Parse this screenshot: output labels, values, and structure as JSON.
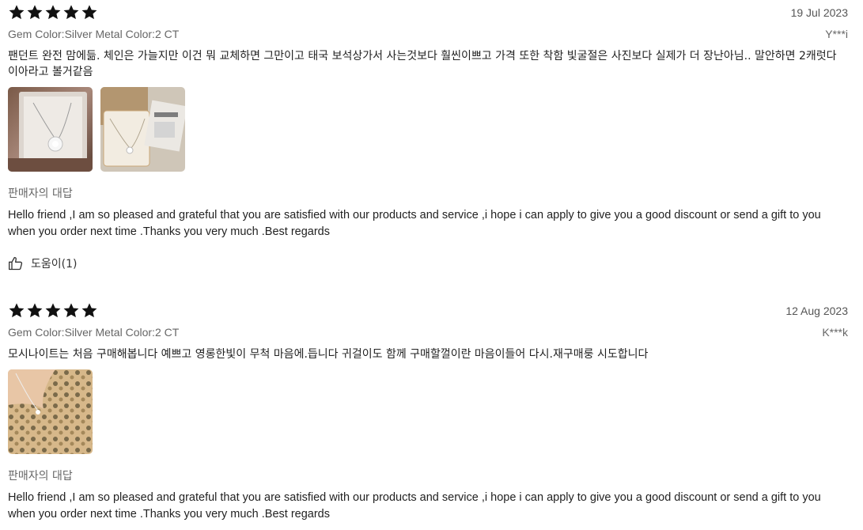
{
  "reviews": [
    {
      "rating": 5,
      "date": "19 Jul 2023",
      "attributes": "Gem Color:Silver Metal Color:2 CT",
      "user": "Y***i",
      "text": "팬던트 완전 맘에듦. 체인은 가늘지만 이건 뭐 교체하면 그만이고 태국 보석상가서 사는것보다 훨씬이쁘고 가격 또한 착함 빛굴절은 사진보다 실제가 더 장난아님.. 말안하면 2캐럿다이아라고 볼거같음",
      "photos": [
        "necklace-photo",
        "jewelry-box-photo"
      ],
      "seller_reply_title": "판매자의 대답",
      "seller_reply": "Hello friend ,I am so pleased and grateful that you are satisfied with our products and service ,i hope i can apply to give you a good discount or send a gift to you when you order next time .Thanks you very much .Best regards",
      "helpful_label": "도움이(1)"
    },
    {
      "rating": 5,
      "date": "12 Aug 2023",
      "attributes": "Gem Color:Silver Metal Color:2 CT",
      "user": "K***k",
      "text": "모시나이트는 처음 구매해봅니다 예쁘고 영롱한빛이 무척 마음에.듭니다 귀걸이도 함께 구매할껄이란 마음이들어 다시.재구매룽 시도합니다",
      "photos": [
        "worn-necklace-photo"
      ],
      "seller_reply_title": "판매자의 대답",
      "seller_reply": "Hello friend ,I am so pleased and grateful that you are satisfied with our products and service ,i hope i can apply to give you a good discount or send a gift to you when you order next time .Thanks you very much .Best regards"
    }
  ],
  "colors": {
    "star": "#111111",
    "muted_text": "#666666",
    "body_text": "#222222"
  }
}
